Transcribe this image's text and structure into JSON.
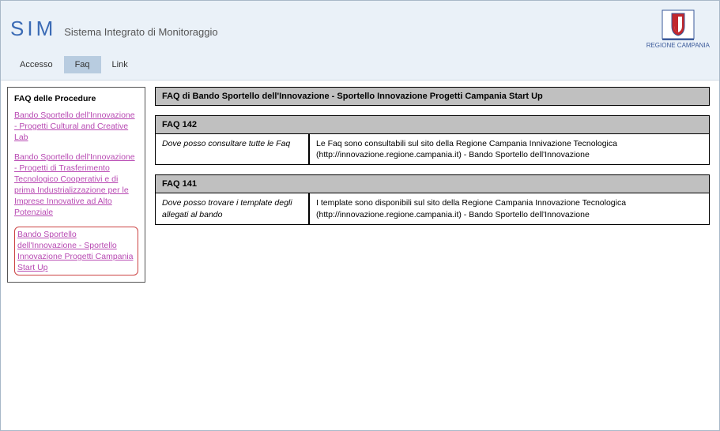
{
  "header": {
    "logo_text": "SIM",
    "subtitle": "Sistema Integrato di Monitoraggio",
    "region_label": "REGIONE CAMPANIA"
  },
  "menu": {
    "accesso": "Accesso",
    "faq": "Faq",
    "link": "Link"
  },
  "sidebar": {
    "title": "FAQ delle Procedure",
    "links": {
      "l1": "Bando Sportello dell'Innovazione - Progetti Cultural and Creative Lab",
      "l2": "Bando Sportello dell'Innovazione - Progetti di Trasferimento Tecnologico Cooperativi e di prima Industrializzazione per le Imprese Innovative ad Alto Potenziale",
      "l3": "Bando Sportello dell'Innovazione - Sportello Innovazione Progetti Campania Start Up"
    }
  },
  "main": {
    "heading": "FAQ di Bando Sportello dell'Innovazione - Sportello Innovazione Progetti Campania Start Up",
    "faq142": {
      "title": "FAQ 142",
      "q": "Dove posso consultare tutte le Faq",
      "a": "Le Faq sono consultabili sul sito della Regione Campania Innivazione Tecnologica (http://innovazione.regione.campania.it) - Bando Sportello dell'Innovazione"
    },
    "faq141": {
      "title": "FAQ 141",
      "q": "Dove posso trovare i template degli allegati al bando",
      "a": "I template sono disponibili sul sito della Regione Campania Innovazione Tecnologica (http://innovazione.regione.campania.it) - Bando Sportello dell'Innovazione"
    }
  }
}
